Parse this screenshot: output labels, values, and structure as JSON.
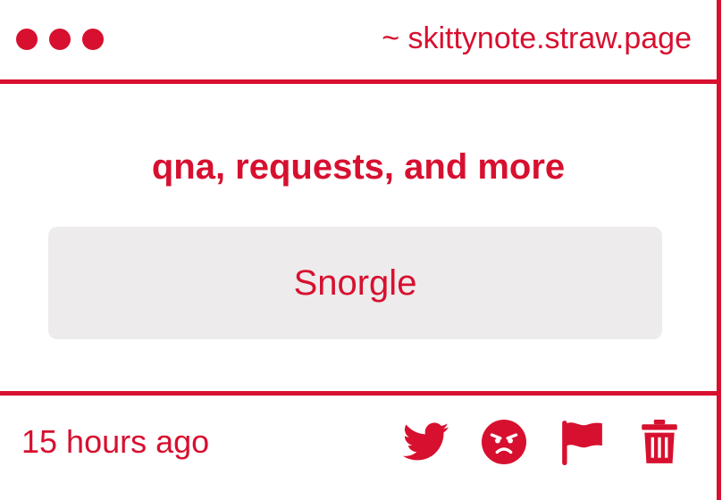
{
  "window": {
    "url": "~ skittynote.straw.page",
    "dots": 3
  },
  "main": {
    "heading": "qna, requests, and more",
    "answer": "Snorgle"
  },
  "footer": {
    "timestamp": "15 hours ago",
    "actions": [
      {
        "icon": "twitter-icon"
      },
      {
        "icon": "angry-face-icon"
      },
      {
        "icon": "flag-icon"
      },
      {
        "icon": "trash-icon"
      }
    ]
  },
  "colors": {
    "accent": "#d7102f",
    "answer_bg": "#edebec",
    "background": "#ffffff"
  }
}
